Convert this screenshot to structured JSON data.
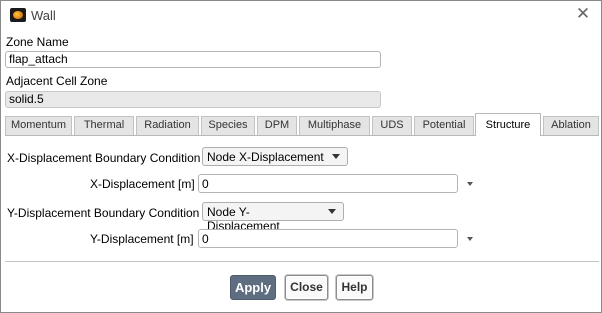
{
  "window": {
    "title": "Wall",
    "icon": "fluent-app-icon"
  },
  "zone_name": {
    "label": "Zone Name",
    "value": "flap_attach"
  },
  "adjacent_cell_zone": {
    "label": "Adjacent Cell Zone",
    "value": "solid.5"
  },
  "tabs": [
    {
      "label": "Momentum",
      "active": false
    },
    {
      "label": "Thermal",
      "active": false
    },
    {
      "label": "Radiation",
      "active": false
    },
    {
      "label": "Species",
      "active": false
    },
    {
      "label": "DPM",
      "active": false
    },
    {
      "label": "Multiphase",
      "active": false
    },
    {
      "label": "UDS",
      "active": false
    },
    {
      "label": "Potential",
      "active": false
    },
    {
      "label": "Structure",
      "active": true
    },
    {
      "label": "Ablation",
      "active": false
    }
  ],
  "structure": {
    "x_bc": {
      "label": "X-Displacement Boundary Condition",
      "selected": "Node X-Displacement"
    },
    "x_disp": {
      "label": "X-Displacement [m]",
      "value": "0"
    },
    "y_bc": {
      "label": "Y-Displacement Boundary Condition",
      "selected": "Node Y-Displacement"
    },
    "y_disp": {
      "label": "Y-Displacement [m]",
      "value": "0"
    }
  },
  "buttons": {
    "apply": "Apply",
    "close": "Close",
    "help": "Help"
  },
  "colors": {
    "primary_button": "#5f6d80",
    "active_tab": "#ffffff",
    "inactive_tab": "#e4e4e4"
  }
}
